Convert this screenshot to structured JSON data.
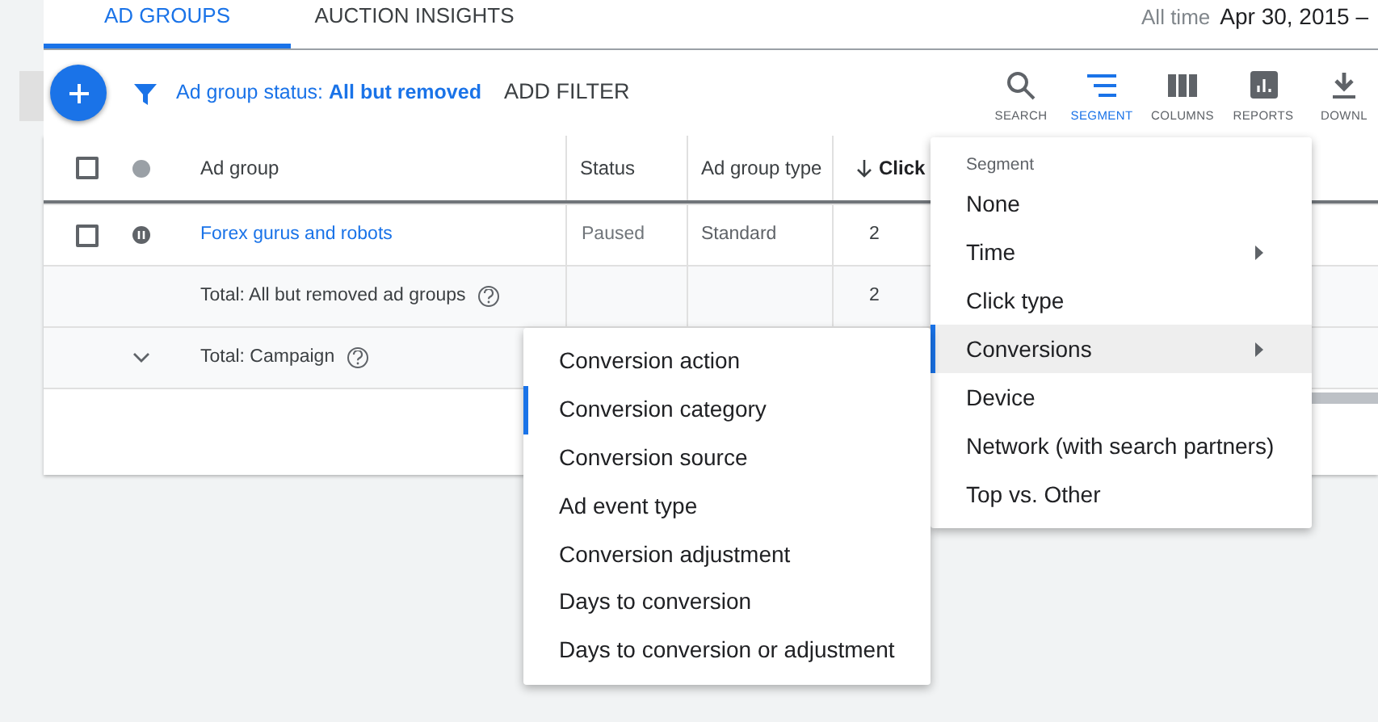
{
  "tabs": [
    {
      "label": "AD GROUPS",
      "selected": true
    },
    {
      "label": "AUCTION INSIGHTS",
      "selected": false
    }
  ],
  "date_range": {
    "label": "All time",
    "value": "Apr 30, 2015 –"
  },
  "toolbar": {
    "filter_label": "Ad group status:",
    "filter_value": "All but removed",
    "add_filter": "ADD FILTER",
    "tools": [
      {
        "kind": "search",
        "label": "SEARCH",
        "selected": false
      },
      {
        "kind": "segment",
        "label": "SEGMENT",
        "selected": true
      },
      {
        "kind": "columns",
        "label": "COLUMNS",
        "selected": false
      },
      {
        "kind": "reports",
        "label": "REPORTS",
        "selected": false
      },
      {
        "kind": "download",
        "label": "DOWNL",
        "selected": false
      }
    ]
  },
  "table": {
    "select_all_checked": false,
    "columns": [
      "Ad group",
      "Status",
      "Ad group type",
      "Click"
    ],
    "rows": [
      {
        "kind": "ad_group",
        "checked": false,
        "name": "Forex gurus and robots",
        "status": "Paused",
        "type": "Standard",
        "clicks": "2"
      },
      {
        "kind": "total",
        "label": "Total: All but removed ad groups",
        "clicks": "2"
      },
      {
        "kind": "campaign_total",
        "label": "Total: Campaign"
      }
    ]
  },
  "segment_menu": {
    "header": "Segment",
    "items": [
      {
        "label": "None",
        "selected": false,
        "submenu": false
      },
      {
        "label": "Time",
        "selected": false,
        "submenu": true
      },
      {
        "label": "Click type",
        "selected": false,
        "submenu": false
      },
      {
        "label": "Conversions",
        "selected": true,
        "submenu": true
      },
      {
        "label": "Device",
        "selected": false,
        "submenu": false
      },
      {
        "label": "Network (with search partners)",
        "selected": false,
        "submenu": false
      },
      {
        "label": "Top vs. Other",
        "selected": false,
        "submenu": false
      }
    ]
  },
  "conversions_submenu": {
    "items": [
      {
        "label": "Conversion action",
        "selected": false
      },
      {
        "label": "Conversion category",
        "selected": true
      },
      {
        "label": "Conversion source",
        "selected": false
      },
      {
        "label": "Ad event type",
        "selected": false
      },
      {
        "label": "Conversion adjustment",
        "selected": false
      },
      {
        "label": "Days to conversion",
        "selected": false
      },
      {
        "label": "Days to conversion or adjustment",
        "selected": false
      }
    ]
  }
}
